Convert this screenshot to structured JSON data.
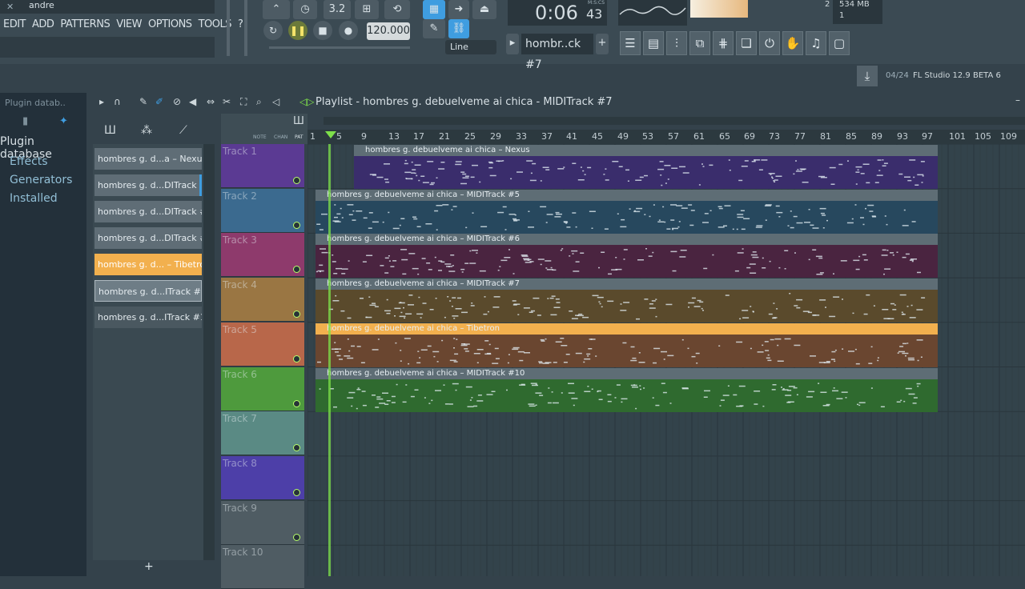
{
  "hint_bar": {
    "close_glyph": "✕",
    "text": "andre"
  },
  "menu": [
    "EDIT",
    "ADD",
    "PATTERNS",
    "VIEW",
    "OPTIONS",
    "TOOLS",
    "?"
  ],
  "transport": {
    "tempo": "120.000",
    "time": "0:06",
    "time_sub": "43",
    "time_label": "M:S:CS",
    "snap": "Line",
    "rate": "3.2"
  },
  "pattern_selector": {
    "value": "hombr..ck #7",
    "plus": "+"
  },
  "memory": {
    "value1": "2",
    "value2": "534 MB",
    "value3": "1"
  },
  "news": {
    "date": "04/24",
    "text": "FL Studio 12.9 BETA 6"
  },
  "browser": {
    "header": "Plugin datab..",
    "title": "Plugin database",
    "items": [
      "Effects",
      "Generators",
      "Installed"
    ]
  },
  "picker": {
    "items": [
      "hombres g. d...a – Nexus",
      "hombres g. d...DITrack #5",
      "hombres g. d...DITrack #6",
      "hombres g. d...DITrack #7",
      "hombres g. d... – Tibetron",
      "hombres g. d...ITrack #10",
      "hombres g. d...ITrack #16"
    ],
    "add": "+"
  },
  "playlist": {
    "title": "Playlist - hombres g. debuelveme ai chica - MIDITrack #7",
    "header_labels": [
      "NOTE",
      "CHAN",
      "PAT"
    ],
    "ruler": [
      "1",
      "5",
      "9",
      "13",
      "17",
      "21",
      "25",
      "29",
      "33",
      "37",
      "41",
      "45",
      "49",
      "53",
      "57",
      "61",
      "65",
      "69",
      "73",
      "77",
      "81",
      "85",
      "89",
      "93",
      "97",
      "101",
      "105",
      "109"
    ],
    "tracks": [
      {
        "name": "Track 1",
        "color": "#5b3a93"
      },
      {
        "name": "Track 2",
        "color": "#3b6a8f"
      },
      {
        "name": "Track 3",
        "color": "#8e3a6c"
      },
      {
        "name": "Track 4",
        "color": "#9a7643"
      },
      {
        "name": "Track 5",
        "color": "#b8674a"
      },
      {
        "name": "Track 6",
        "color": "#4e9a3d"
      },
      {
        "name": "Track 7",
        "color": "#5a8a84"
      },
      {
        "name": "Track 8",
        "color": "#4d3fa8"
      },
      {
        "name": "Track 9",
        "color": "#4f5c63"
      },
      {
        "name": "Track 10",
        "color": "#4f5c63"
      }
    ],
    "clips": [
      {
        "label": "hombres g. debuelveme ai chica – Nexus",
        "color": "#3a2d6c"
      },
      {
        "label": "hombres g. debuelveme ai chica – MIDITrack #5",
        "color": "#27485e"
      },
      {
        "label": "hombres g. debuelveme ai chica – MIDITrack #6",
        "color": "#4a2440"
      },
      {
        "label": "hombres g. debuelveme ai chica – MIDITrack #7",
        "color": "#5a4a2c"
      },
      {
        "label": "hombres g. debuelveme ai chica – Tibetron",
        "color": "#6a4630"
      },
      {
        "label": "hombres g. debuelveme ai chica – MIDITrack #10",
        "color": "#2f6a2f"
      }
    ]
  },
  "colors": {
    "accent": "#f2b04e",
    "playhead": "#7ee04a"
  }
}
